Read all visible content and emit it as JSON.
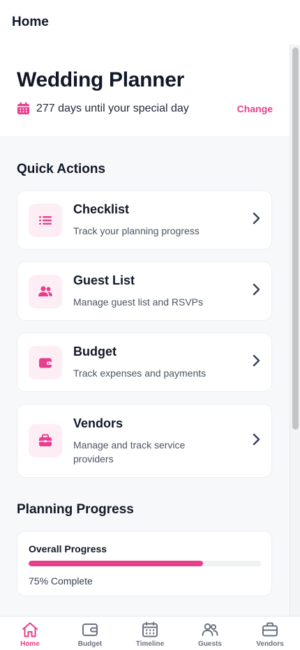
{
  "header": {
    "title": "Home"
  },
  "hero": {
    "title": "Wedding Planner",
    "countdown": "277 days until your special day",
    "change_label": "Change"
  },
  "quick_actions": {
    "title": "Quick Actions",
    "items": [
      {
        "title": "Checklist",
        "subtitle": "Track your planning progress",
        "icon": "list-icon"
      },
      {
        "title": "Guest List",
        "subtitle": "Manage guest list and RSVPs",
        "icon": "users-icon"
      },
      {
        "title": "Budget",
        "subtitle": "Track expenses and payments",
        "icon": "wallet-icon"
      },
      {
        "title": "Vendors",
        "subtitle": "Manage and track service providers",
        "icon": "briefcase-icon"
      }
    ]
  },
  "planning_progress": {
    "title": "Planning Progress",
    "label": "Overall Progress",
    "percent": 75,
    "percent_text": "75% Complete"
  },
  "bottom_nav": {
    "items": [
      {
        "label": "Home",
        "icon": "home-icon",
        "active": true
      },
      {
        "label": "Budget",
        "icon": "wallet-icon",
        "active": false
      },
      {
        "label": "Timeline",
        "icon": "calendar-icon",
        "active": false
      },
      {
        "label": "Guests",
        "icon": "users-icon",
        "active": false
      },
      {
        "label": "Vendors",
        "icon": "briefcase-icon",
        "active": false
      }
    ]
  },
  "colors": {
    "accent": "#e83e8c",
    "accent_bg": "#fdeef5",
    "muted": "#6b7280"
  }
}
